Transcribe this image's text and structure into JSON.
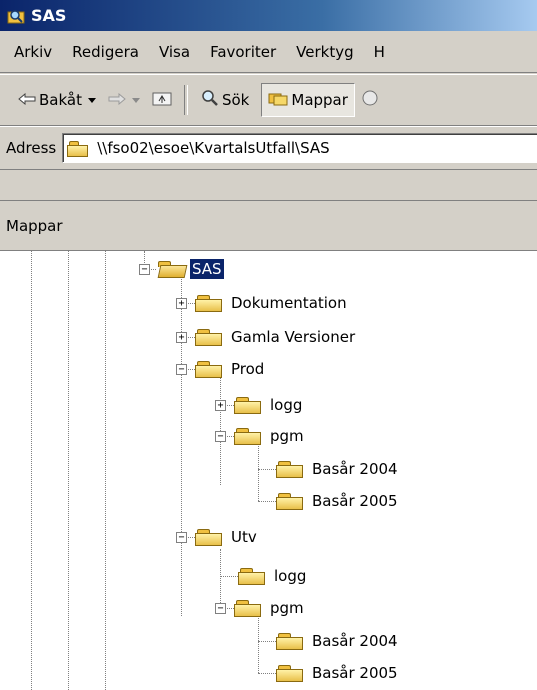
{
  "window": {
    "title": "SAS",
    "app_icon": "search-folder-icon"
  },
  "menu": [
    "Arkiv",
    "Redigera",
    "Visa",
    "Favoriter",
    "Verktyg",
    "H"
  ],
  "toolbar": {
    "back_label": "Bakåt",
    "search_label": "Sök",
    "folders_label": "Mappar"
  },
  "address": {
    "label": "Adress",
    "value": "\\\\fso02\\esoe\\KvartalsUtfall\\SAS"
  },
  "folders_pane": {
    "title": "Mappar"
  },
  "tree": [
    {
      "label": "SAS",
      "selected": true,
      "expander": "−"
    },
    {
      "label": "Dokumentation",
      "expander": "+"
    },
    {
      "label": "Gamla Versioner",
      "expander": "+"
    },
    {
      "label": "Prod",
      "expander": "−"
    },
    {
      "label": "logg",
      "expander": "+"
    },
    {
      "label": "pgm",
      "expander": "−"
    },
    {
      "label": "Basår 2004"
    },
    {
      "label": "Basår 2005"
    },
    {
      "label": "Utv",
      "expander": "−"
    },
    {
      "label": "logg"
    },
    {
      "label": "pgm",
      "expander": "−"
    },
    {
      "label": "Basår 2004"
    },
    {
      "label": "Basår 2005"
    }
  ],
  "colors": {
    "selection": "#0a246a",
    "titlebar": "#0a246a",
    "chrome": "#d4d0c8"
  }
}
